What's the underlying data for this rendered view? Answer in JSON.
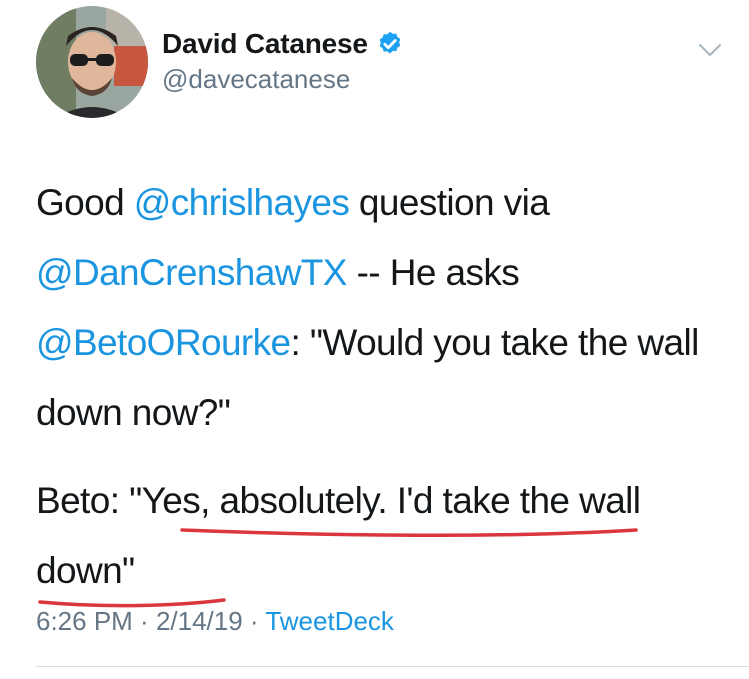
{
  "author": {
    "name": "David Catanese",
    "handle": "@davecatanese",
    "verified": true,
    "avatar_icon": "profile-photo"
  },
  "tweet": {
    "p1": {
      "t1": "Good ",
      "m1": "@chrislhayes",
      "t2": " question via ",
      "m2": "@DanCrenshawTX",
      "t3": " -- He asks ",
      "m3": "@BetoORourke",
      "t4": ": \"Would you take the wall down now?\""
    },
    "p2": "Beto: \"Yes, absolutely. I'd take the wall down\""
  },
  "meta": {
    "time": "6:26 PM",
    "separator": " · ",
    "date": "2/14/19",
    "client": "TweetDeck"
  },
  "colors": {
    "link": "#1b95e0",
    "secondary": "#657786",
    "underline": "#d9363e",
    "verified": "#1da1f2"
  }
}
